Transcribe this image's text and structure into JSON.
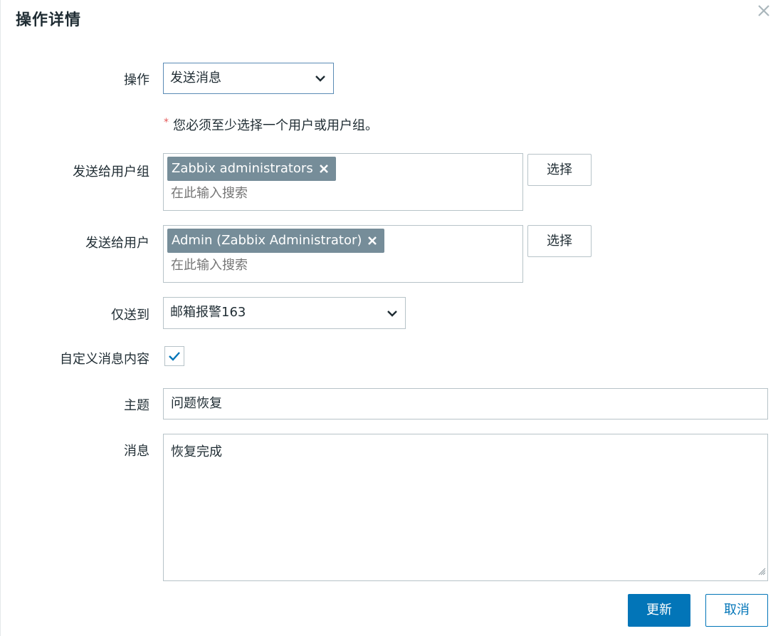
{
  "dialog": {
    "title": "操作详情",
    "close_icon": "close-icon"
  },
  "form": {
    "operation": {
      "label": "操作",
      "value": "发送消息"
    },
    "required_note": "您必须至少选择一个用户或用户组。",
    "send_to_groups": {
      "label": "发送给用户组",
      "tags": [
        "Zabbix administrators"
      ],
      "placeholder": "在此输入搜索",
      "select_button": "选择"
    },
    "send_to_users": {
      "label": "发送给用户",
      "tags": [
        "Admin (Zabbix Administrator)"
      ],
      "placeholder": "在此输入搜索",
      "select_button": "选择"
    },
    "send_only_to": {
      "label": "仅送到",
      "value": "邮箱报警163"
    },
    "custom_message": {
      "label": "自定义消息内容",
      "checked": true
    },
    "subject": {
      "label": "主题",
      "value": "问题恢复"
    },
    "message": {
      "label": "消息",
      "value": "恢复完成"
    }
  },
  "footer": {
    "update_button": "更新",
    "cancel_button": "取消"
  },
  "colors": {
    "primary": "#0275b8",
    "tag_bg": "#768d99",
    "required_star": "#e45959",
    "border": "#b7c3c8"
  }
}
